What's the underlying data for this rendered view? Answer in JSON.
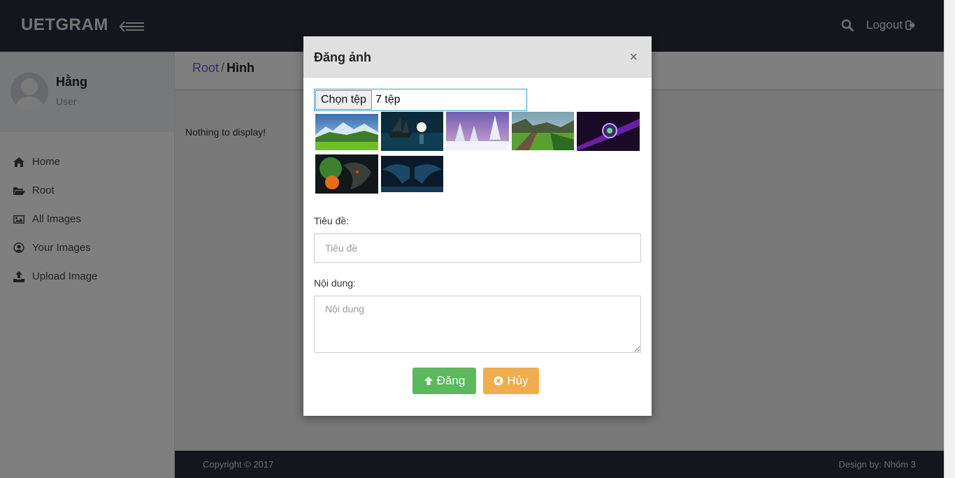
{
  "topbar": {
    "brand": "UETGRAM",
    "logout_label": "Logout"
  },
  "sidebar": {
    "user": {
      "name": "Hằng",
      "role": "User"
    },
    "items": [
      {
        "label": "Home",
        "icon": "home-icon"
      },
      {
        "label": "Root",
        "icon": "folder-open-icon"
      },
      {
        "label": "All Images",
        "icon": "image-icon"
      },
      {
        "label": "Your Images",
        "icon": "user-circle-icon"
      },
      {
        "label": "Upload Image",
        "icon": "upload-icon"
      }
    ]
  },
  "breadcrumb": {
    "root": "Root",
    "separator": "/",
    "current": "Hình"
  },
  "main": {
    "empty_message": "Nothing to display!"
  },
  "footer": {
    "copyright": "Copyright © 2017",
    "design": "Design by: Nhóm 3"
  },
  "modal": {
    "title": "Đăng ảnh",
    "close": "×",
    "file_button": "Chọn tệp",
    "file_count": "7 tệp",
    "thumbnails": [
      {
        "name": "thumb-mountain-meadow"
      },
      {
        "name": "thumb-ship-moon"
      },
      {
        "name": "thumb-snowy-forest"
      },
      {
        "name": "thumb-railway-landscape"
      },
      {
        "name": "thumb-purple-orb"
      },
      {
        "name": "thumb-fire-dragon"
      },
      {
        "name": "thumb-dark-angel"
      }
    ],
    "title_label": "Tiêu đề:",
    "title_placeholder": "Tiêu đề",
    "content_label": "Nội dung:",
    "content_placeholder": "Nội dung",
    "post_button": "Đăng",
    "cancel_button": "Hủy"
  },
  "colors": {
    "navbar": "#2a2d3a",
    "success": "#5cb85c",
    "warning": "#f0ad4e",
    "breadcrumb_link": "#6a5acd"
  }
}
